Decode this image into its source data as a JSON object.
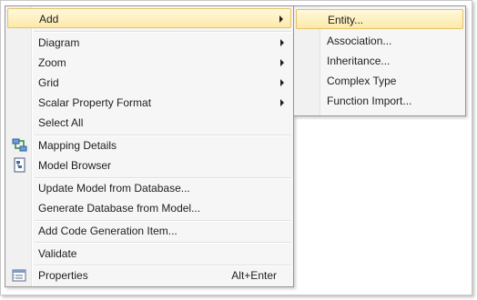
{
  "menu": {
    "items": [
      {
        "label": "Add",
        "submenu": true,
        "highlighted": true
      },
      {
        "label": "Diagram",
        "submenu": true
      },
      {
        "label": "Zoom",
        "submenu": true
      },
      {
        "label": "Grid",
        "submenu": true
      },
      {
        "label": "Scalar Property Format",
        "submenu": true
      },
      {
        "label": "Select All"
      },
      {
        "label": "Mapping Details",
        "icon": "mapping-details-icon"
      },
      {
        "label": "Model Browser",
        "icon": "model-browser-icon"
      },
      {
        "label": "Update Model from Database..."
      },
      {
        "label": "Generate Database from Model..."
      },
      {
        "label": "Add Code Generation Item..."
      },
      {
        "label": "Validate"
      },
      {
        "label": "Properties",
        "icon": "properties-icon",
        "shortcut": "Alt+Enter"
      }
    ]
  },
  "submenu": {
    "items": [
      {
        "label": "Entity...",
        "highlighted": true
      },
      {
        "label": "Association..."
      },
      {
        "label": "Inheritance..."
      },
      {
        "label": "Complex Type"
      },
      {
        "label": "Function Import..."
      }
    ]
  },
  "colors": {
    "menu_background": "#f6f6f6",
    "highlight_top": "#fef8dc",
    "highlight_bottom": "#fde9a8",
    "highlight_border": "#e4c365"
  }
}
